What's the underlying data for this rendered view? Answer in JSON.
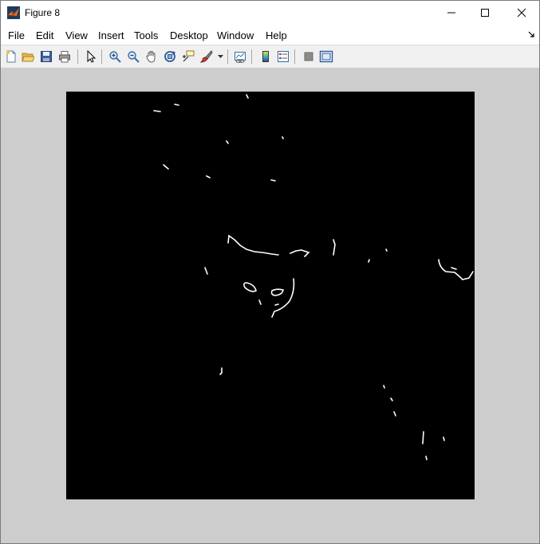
{
  "window": {
    "title": "Figure 8"
  },
  "menubar": {
    "items": [
      "File",
      "Edit",
      "View",
      "Insert",
      "Tools",
      "Desktop",
      "Window",
      "Help"
    ]
  },
  "toolbar": {
    "buttons": [
      "new-figure-icon",
      "open-file-icon",
      "save-icon",
      "print-icon",
      "select-arrow-icon",
      "zoom-in-icon",
      "zoom-out-icon",
      "pan-hand-icon",
      "rotate-3d-icon",
      "data-cursor-icon",
      "brush-icon",
      "link-plot-icon",
      "colorbar-icon",
      "legend-icon",
      "hide-plot-tools-icon",
      "show-plot-tools-icon"
    ]
  },
  "figure": {
    "image": "binary edge-detection image on black background",
    "edge_color": "#ffffff",
    "background_color": "#000000"
  }
}
